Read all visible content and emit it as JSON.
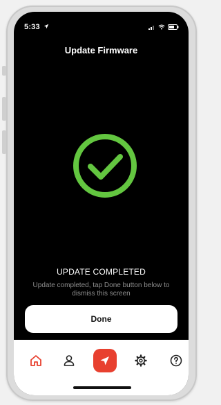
{
  "status_bar": {
    "time": "5:33",
    "icons": [
      "location-arrow-icon",
      "signal-icon",
      "wifi-icon",
      "battery-icon"
    ]
  },
  "header": {
    "title": "Update Firmware"
  },
  "status": {
    "icon": "check-circle-icon",
    "heading": "UPDATE COMPLETED",
    "description": "Update completed, tap Done button below to dismiss this screen"
  },
  "actions": {
    "done_label": "Done"
  },
  "tabbar": {
    "items": [
      {
        "icon": "home-icon"
      },
      {
        "icon": "user-icon"
      },
      {
        "icon": "navigation-arrow-icon",
        "active": true
      },
      {
        "icon": "gear-icon"
      },
      {
        "icon": "help-icon"
      }
    ]
  },
  "colors": {
    "screen_background": "#000000",
    "success": "#63c640",
    "accent": "#e8402f",
    "muted_text": "#8e8e8e",
    "button_background": "#ffffff"
  }
}
